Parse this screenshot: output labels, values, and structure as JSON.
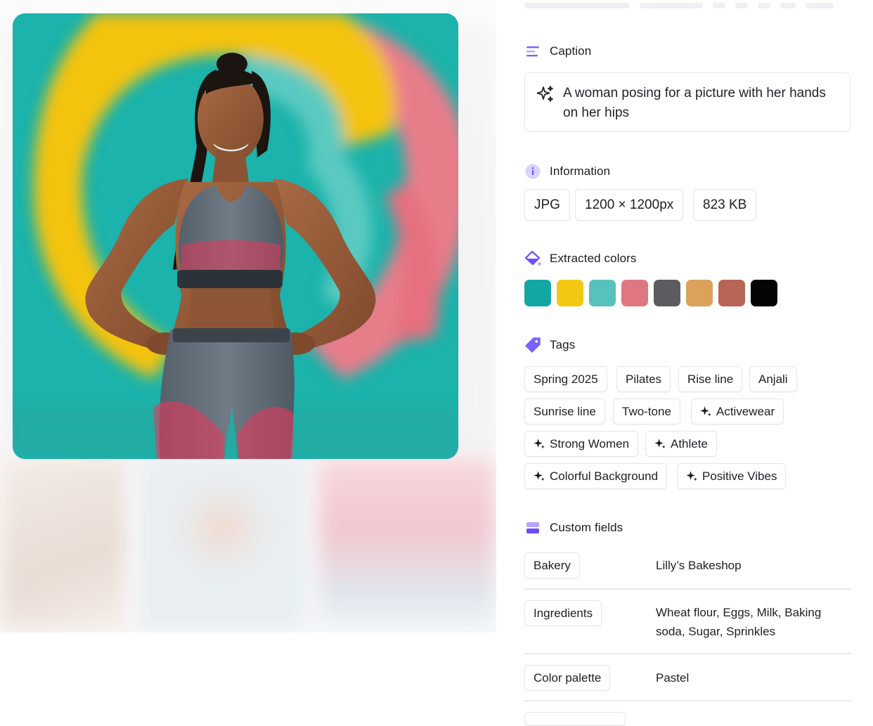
{
  "caption": {
    "heading": "Caption",
    "text": "A woman posing for a picture with her hands on her hips"
  },
  "information": {
    "heading": "Information",
    "format": "JPG",
    "dimensions": "1200 × 1200px",
    "size": "823 KB"
  },
  "extracted_colors": {
    "heading": "Extracted colors",
    "swatches": [
      "#13a7a3",
      "#f3c813",
      "#57c2bb",
      "#e07682",
      "#5b5b60",
      "#daa25a",
      "#b86456",
      "#050505"
    ]
  },
  "tags": {
    "heading": "Tags",
    "items": [
      {
        "label": "Spring 2025",
        "ai": false
      },
      {
        "label": "Pilates",
        "ai": false
      },
      {
        "label": "Rise line",
        "ai": false
      },
      {
        "label": "Anjali",
        "ai": false
      },
      {
        "label": "Sunrise line",
        "ai": false
      },
      {
        "label": "Two-tone",
        "ai": false
      },
      {
        "label": "Activewear",
        "ai": true
      },
      {
        "label": "Strong Women",
        "ai": true
      },
      {
        "label": "Athlete",
        "ai": true
      },
      {
        "label": "Colorful Background",
        "ai": true
      },
      {
        "label": "Positive Vibes",
        "ai": true
      }
    ]
  },
  "custom_fields": {
    "heading": "Custom fields",
    "rows": [
      {
        "key": "Bakery",
        "value": "Lilly’s Bakeshop"
      },
      {
        "key": "Ingredients",
        "value": "Wheat flour, Eggs, Milk, Baking soda, Sugar, Sprinkles"
      },
      {
        "key": "Color palette",
        "value": "Pastel"
      }
    ]
  },
  "icons": {
    "caption": "caption-lines-icon",
    "information": "info-icon",
    "colors": "paint-bucket-icon",
    "tags": "tag-icon",
    "custom_fields": "custom-fields-icon",
    "ai_tag": "sparkle-icon"
  },
  "accent": "#7b61ff"
}
